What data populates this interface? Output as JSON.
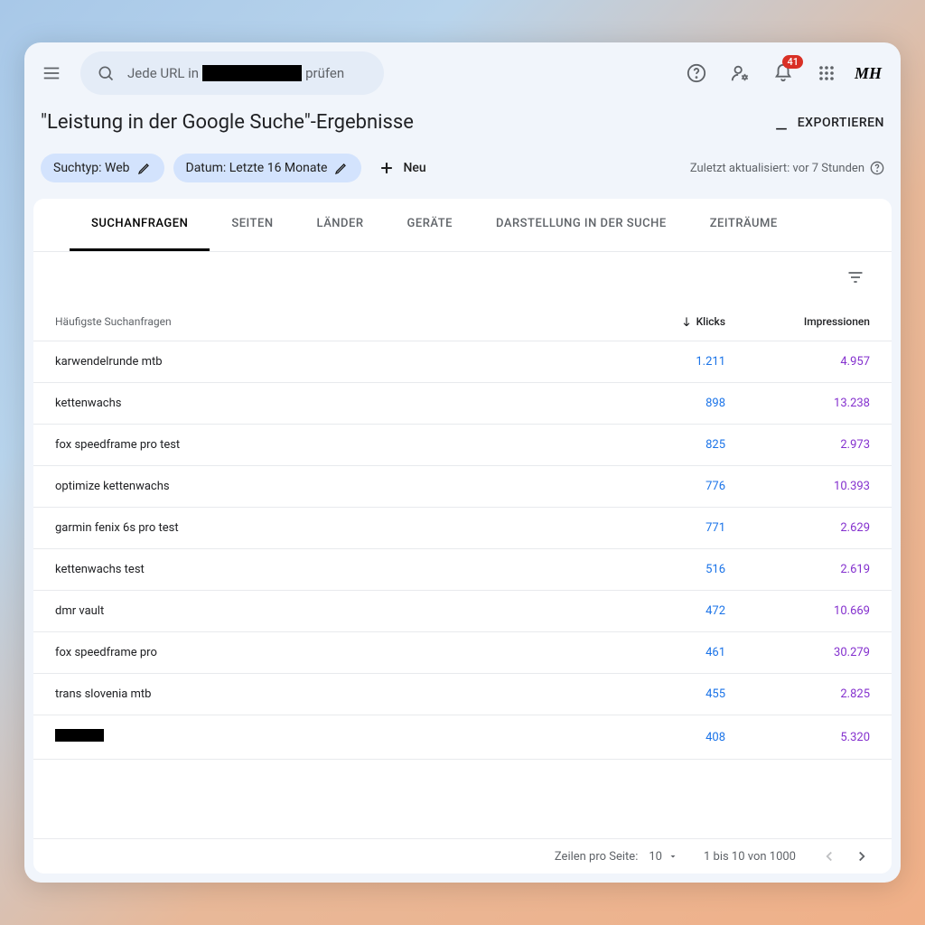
{
  "search": {
    "placeholder": "Jede URL in ████████ prüfen",
    "prefix": "Jede URL in",
    "suffix": "prüfen"
  },
  "notifications": {
    "count": "41"
  },
  "avatar": "MH",
  "page_title": "\"Leistung in der Google Suche\"-Ergebnisse",
  "export_label": "EXPORTIEREN",
  "chips": {
    "type": "Suchtyp: Web",
    "date": "Datum: Letzte 16 Monate",
    "new": "Neu"
  },
  "updated": "Zuletzt aktualisiert: vor 7 Stunden",
  "tabs": [
    "SUCHANFRAGEN",
    "SEITEN",
    "LÄNDER",
    "GERÄTE",
    "DARSTELLUNG IN DER SUCHE",
    "ZEITRÄUME"
  ],
  "columns": {
    "query": "Häufigste Suchanfragen",
    "clicks": "Klicks",
    "impressions": "Impressionen"
  },
  "rows": [
    {
      "q": "karwendelrunde mtb",
      "k": "1.211",
      "i": "4.957"
    },
    {
      "q": "kettenwachs",
      "k": "898",
      "i": "13.238"
    },
    {
      "q": "fox speedframe pro test",
      "k": "825",
      "i": "2.973"
    },
    {
      "q": "optimize kettenwachs",
      "k": "776",
      "i": "10.393"
    },
    {
      "q": "garmin fenix 6s pro test",
      "k": "771",
      "i": "2.629"
    },
    {
      "q": "kettenwachs test",
      "k": "516",
      "i": "2.619"
    },
    {
      "q": "dmr vault",
      "k": "472",
      "i": "10.669"
    },
    {
      "q": "fox speedframe pro",
      "k": "461",
      "i": "30.279"
    },
    {
      "q": "trans slovenia mtb",
      "k": "455",
      "i": "2.825"
    },
    {
      "q": "████",
      "k": "408",
      "i": "5.320"
    }
  ],
  "footer": {
    "rpp_label": "Zeilen pro Seite:",
    "rpp_value": "10",
    "range": "1 bis 10 von 1000"
  }
}
